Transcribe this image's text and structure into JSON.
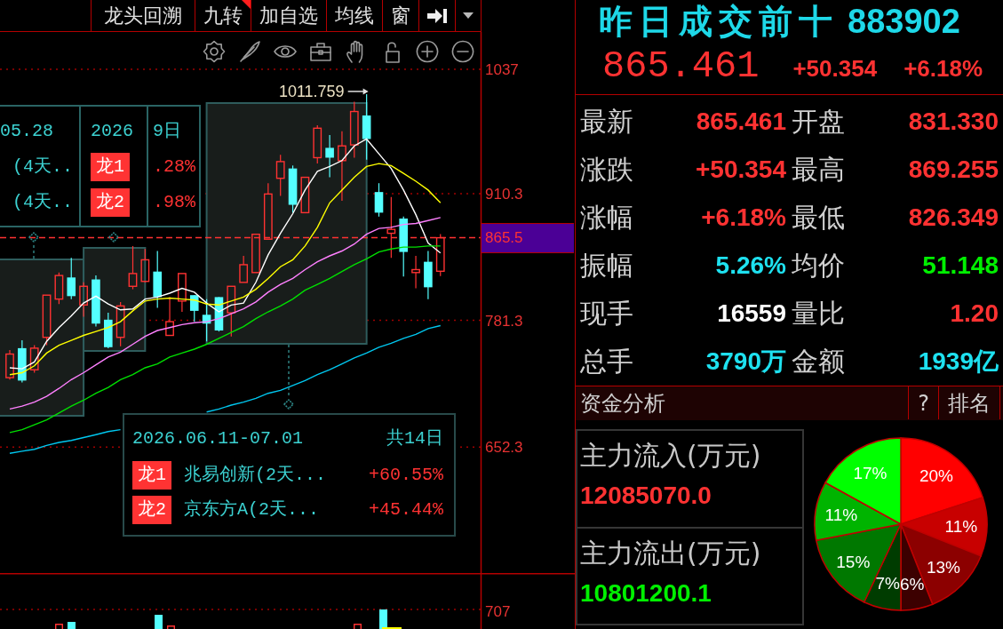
{
  "toolbar": {
    "buttons": [
      {
        "label": "龙头回溯",
        "flagged": false
      },
      {
        "label": "九转",
        "flagged": true
      },
      {
        "label": "加自选",
        "flagged": false
      },
      {
        "label": "均线",
        "flagged": false
      },
      {
        "label": "窗",
        "flagged": false
      }
    ]
  },
  "price_chart": {
    "upper_panel": {
      "header": [
        "05.28",
        "2026",
        "9日"
      ],
      "rows": [
        {
          "name": "(4天..",
          "badge": "龙1",
          "change": ".28%"
        },
        {
          "name": "(4天..",
          "badge": "龙2",
          "change": ".98%"
        }
      ]
    },
    "lower_panel": {
      "date_range": "2026.06.11-07.01",
      "total": "共14日",
      "rows": [
        {
          "badge": "龙1",
          "name": "兆易创新(2天...",
          "change": "+60.55%"
        },
        {
          "badge": "龙2",
          "name": "京东方A(2天...",
          "change": "+45.44%"
        }
      ]
    },
    "chart_data": [
      {
        "type": "candlestick",
        "ohlc": [
          [
            723,
            751,
            721,
            747
          ],
          [
            753,
            761,
            718,
            720
          ],
          [
            731,
            756,
            728,
            753
          ],
          [
            764,
            807,
            756,
            807
          ],
          [
            803,
            830,
            798,
            827
          ],
          [
            825,
            845,
            803,
            806
          ],
          [
            797,
            820,
            785,
            816
          ],
          [
            823,
            827,
            775,
            778
          ],
          [
            782,
            789,
            753,
            754
          ],
          [
            764,
            800,
            755,
            796
          ],
          [
            816,
            857,
            813,
            829
          ],
          [
            821,
            854,
            820,
            843
          ],
          [
            831,
            852,
            794,
            805
          ],
          [
            766,
            805,
            766,
            780
          ],
          [
            801,
            829,
            790,
            829
          ],
          [
            807,
            807,
            780,
            791
          ],
          [
            787,
            803,
            760,
            778
          ],
          [
            805,
            805,
            770,
            771
          ],
          [
            789,
            816,
            765,
            816
          ],
          [
            820,
            847,
            820,
            838
          ],
          [
            830,
            869,
            830,
            869
          ],
          [
            864,
            921,
            864,
            910
          ],
          [
            926,
            950,
            908,
            943
          ],
          [
            936,
            939,
            891,
            899
          ],
          [
            891,
            927,
            891,
            927
          ],
          [
            947,
            980,
            941,
            977
          ],
          [
            957,
            970,
            927,
            947
          ],
          [
            944,
            974,
            903,
            959
          ],
          [
            960,
            1004,
            947,
            994
          ],
          [
            990,
            1011.759,
            945,
            966
          ],
          [
            912,
            921,
            887,
            891
          ],
          [
            870,
            907,
            845,
            874
          ],
          [
            885,
            887,
            826,
            851
          ],
          [
            830,
            847,
            814,
            833
          ],
          [
            841,
            852,
            803,
            815
          ],
          [
            831.33,
            869.255,
            826.349,
            865.461
          ]
        ],
        "series": [
          {
            "type": "line",
            "color": "#ffffff",
            "values": [
              733,
              732,
              739,
              760,
              774,
              786,
              799,
              806,
              798,
              792,
              793,
              803,
              805,
              809,
              814,
              810,
              799,
              790,
              797,
              799,
              820,
              848,
              870,
              890,
              914,
              933,
              938,
              944,
              959,
              966,
              951,
              936,
              914,
              889,
              860,
              850
            ]
          },
          {
            "type": "line",
            "color": "#ffff00",
            "values": [
              726,
              728,
              735,
              748,
              756,
              761,
              766,
              770,
              774,
              780,
              791,
              801,
              803,
              804,
              803,
              802,
              798,
              797,
              801,
              805,
              813,
              824,
              836,
              843,
              857,
              876,
              901,
              914,
              927,
              938,
              941,
              939,
              931,
              923,
              914,
              901
            ]
          },
          {
            "type": "line",
            "color": "#ff80ff",
            "values": [
              691,
              694,
              698,
              704,
              712,
              721,
              728,
              736,
              744,
              749,
              757,
              765,
              771,
              774,
              777,
              779,
              780,
              783,
              788,
              793,
              800,
              810,
              818,
              824,
              833,
              841,
              847,
              852,
              859,
              869,
              875,
              876,
              879,
              880,
              883,
              886
            ]
          },
          {
            "type": "line",
            "color": "#00e000",
            "values": [
              667,
              670,
              675,
              680,
              687,
              694,
              700,
              707,
              713,
              721,
              726,
              733,
              737,
              744,
              748,
              752,
              757,
              763,
              769,
              775,
              783,
              790,
              796,
              803,
              812,
              818,
              824,
              831,
              838,
              844,
              851,
              854,
              856,
              856,
              857,
              857
            ]
          },
          {
            "type": "line",
            "color": "#00c8f0",
            "values": [
              646,
              648,
              650,
              654,
              657,
              659,
              662,
              665,
              668,
              670,
              null,
              null,
              null,
              null,
              null,
              null,
              688,
              691,
              695,
              698,
              702,
              707,
              710,
              715,
              720,
              726,
              731,
              737,
              743,
              748,
              754,
              758,
              763,
              767,
              773,
              776
            ]
          }
        ],
        "yticks": [
          1037,
          910.3,
          781.3,
          652.3
        ],
        "ylim": [
          467,
          1075
        ],
        "grid": true,
        "ref_lines": [
          {
            "axis": "y",
            "value": 865.5,
            "label": "865.5",
            "color": "#ff3232",
            "line_style": "dashed"
          }
        ],
        "annotations": [
          "1011.759"
        ]
      }
    ]
  },
  "volume_pane": {
    "tick_label": "707"
  },
  "quote": {
    "name": "昨日成交前十",
    "code": "883902",
    "price": "865.461",
    "change": "+50.354",
    "change_pct": "+6.18%"
  },
  "stats": [
    {
      "label": "最新",
      "value": "865.461",
      "color": "#ff3232"
    },
    {
      "label": "开盘",
      "value": "831.330",
      "color": "#ff3232"
    },
    {
      "label": "涨跌",
      "value": "+50.354",
      "color": "#ff3232"
    },
    {
      "label": "最高",
      "value": "869.255",
      "color": "#ff3232"
    },
    {
      "label": "涨幅",
      "value": "+6.18%",
      "color": "#ff3232"
    },
    {
      "label": "最低",
      "value": "826.349",
      "color": "#ff3232"
    },
    {
      "label": "振幅",
      "value": "5.26%",
      "color": "#1ee1f0"
    },
    {
      "label": "均价",
      "value": "51.148",
      "color": "#00f000"
    },
    {
      "label": "现手",
      "value": "16559",
      "color": "#ffffff"
    },
    {
      "label": "量比",
      "value": "1.20",
      "color": "#ff3232"
    },
    {
      "label": "总手",
      "value": "3790万",
      "color": "#1ee1f0"
    },
    {
      "label": "金额",
      "value": "1939亿",
      "color": "#1ee1f0"
    }
  ],
  "fund_analysis": {
    "title": "资金分析",
    "buttons": [
      "?",
      "排名"
    ],
    "flows": [
      {
        "label": "主力流入(万元)",
        "value": "12085070.0",
        "color": "#ff3232"
      },
      {
        "label": "主力流出(万元)",
        "value": "10801200.1",
        "color": "#00f000"
      }
    ],
    "chart_data": [
      {
        "type": "pie",
        "values": [
          20,
          11,
          13,
          6,
          7,
          15,
          11,
          17
        ],
        "colors": [
          "#ff0000",
          "#c80000",
          "#8c0000",
          "#3c0000",
          "#003c00",
          "#007800",
          "#00b400",
          "#00ff00"
        ],
        "value_labels": [
          "20%",
          "11%",
          "13%",
          "6%",
          "7%",
          "15%",
          "11%",
          "17%"
        ]
      }
    ]
  }
}
